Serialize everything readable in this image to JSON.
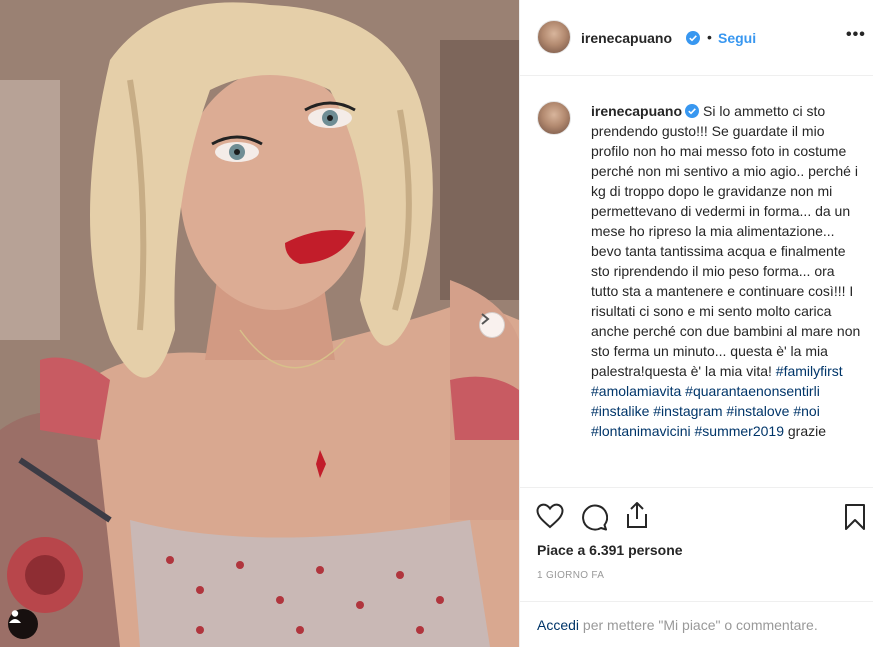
{
  "post": {
    "photo": {
      "image_name": "selfie-photo",
      "carousel_next_icon": "chevron-right-icon",
      "tag_icon": "user-icon"
    },
    "author": {
      "username": "irenecapuano",
      "verified": true,
      "follow_label": "Segui",
      "more_icon": "more-options-icon",
      "separator": "•"
    },
    "caption": {
      "username": "irenecapuano",
      "text": "Si lo ammetto ci sto prendendo gusto!!! Se guardate il mio profilo non ho mai messo foto in costume perché non mi sentivo a mio agio.. perché i kg di troppo dopo le gravidanze non mi permettevano di vedermi in forma... da un mese ho ripreso la mia alimentazione... bevo tanta tantissima acqua e finalmente sto riprendendo il mio peso forma... ora tutto sta a mantenere e continuare così!!! I risultati ci sono e mi sento molto carica anche perché con due bambini al mare non sto ferma un minuto... questa è' la mia palestra!questa è' la mia vita!",
      "hashtags": [
        "#familyfirst",
        "#amolamiavita",
        "#quarantaenonsentirli",
        "#instalike",
        "#instagram",
        "#instalove",
        "#noi",
        "#lontanimavicini",
        "#summer2019"
      ],
      "trailing": "grazie"
    },
    "actions": {
      "like_icon": "heart-icon",
      "comment_icon": "comment-icon",
      "share_icon": "share-icon",
      "save_icon": "bookmark-icon"
    },
    "likes_text": "Piace a 6.391 persone",
    "timestamp": "1 GIORNO FA",
    "footer": {
      "login_label": "Accedi",
      "rest": "per mettere \"Mi piace\" o commentare."
    },
    "colors": {
      "link": "#3897f0",
      "hashtag": "#003569",
      "muted": "#999999",
      "verified_badge": "#3897f0"
    }
  }
}
